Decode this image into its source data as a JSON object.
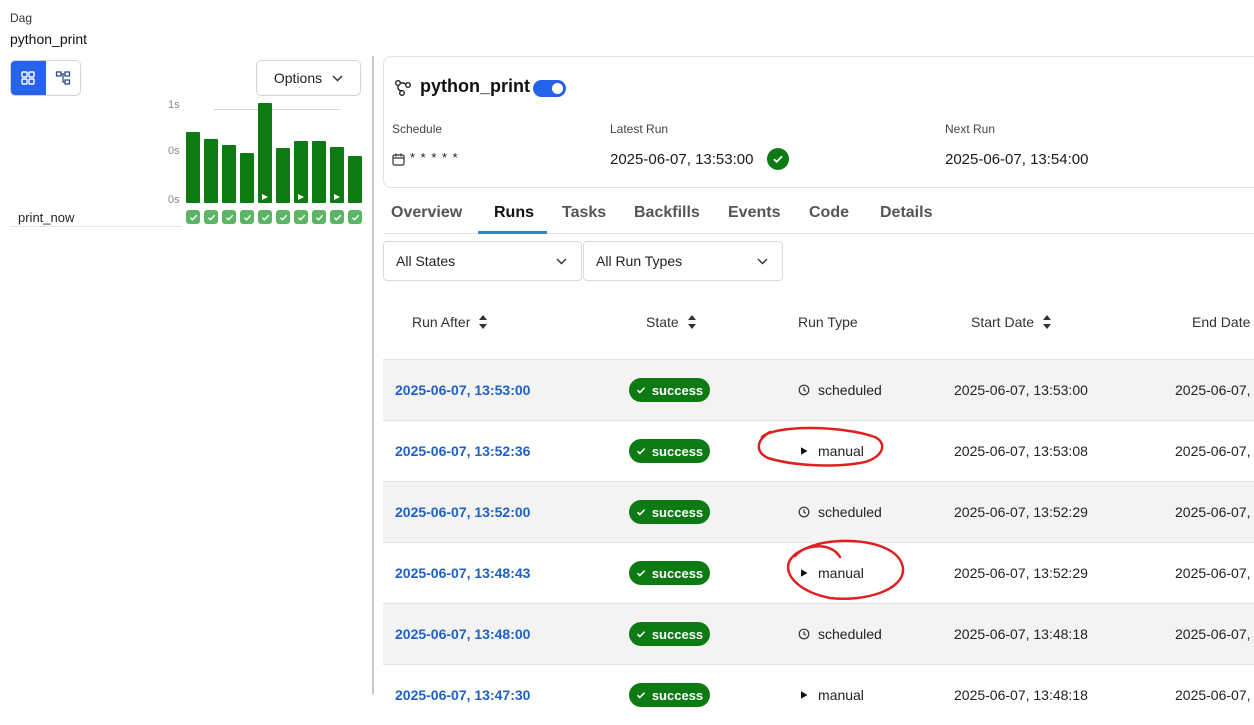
{
  "header": {
    "label": "Dag",
    "dag_name": "python_print"
  },
  "left_panel": {
    "options_label": "Options",
    "axis_labels": [
      "1s",
      "0s",
      "0s"
    ],
    "task_name": "print_now",
    "run_bars": [
      {
        "duration_fraction": 0.71,
        "manual": false
      },
      {
        "duration_fraction": 0.64,
        "manual": false
      },
      {
        "duration_fraction": 0.58,
        "manual": false
      },
      {
        "duration_fraction": 0.5,
        "manual": false
      },
      {
        "duration_fraction": 1.0,
        "manual": true
      },
      {
        "duration_fraction": 0.55,
        "manual": false
      },
      {
        "duration_fraction": 0.62,
        "manual": true
      },
      {
        "duration_fraction": 0.62,
        "manual": false
      },
      {
        "duration_fraction": 0.56,
        "manual": true
      },
      {
        "duration_fraction": 0.47,
        "manual": false
      }
    ]
  },
  "card": {
    "title": "python_print",
    "schedule_label": "Schedule",
    "schedule_value": "* * * * *",
    "latest_run_label": "Latest Run",
    "latest_run_value": "2025-06-07, 13:53:00",
    "next_run_label": "Next Run",
    "next_run_value": "2025-06-07, 13:54:00"
  },
  "tabs": [
    "Overview",
    "Runs",
    "Tasks",
    "Backfills",
    "Events",
    "Code",
    "Details"
  ],
  "active_tab": "Runs",
  "filters": {
    "state": "All States",
    "run_type": "All Run Types"
  },
  "table": {
    "headers": {
      "run_after": "Run After",
      "state": "State",
      "run_type": "Run Type",
      "start_date": "Start Date",
      "end_date": "End Date"
    },
    "rows": [
      {
        "run_after": "2025-06-07, 13:53:00",
        "state": "success",
        "run_type": "scheduled",
        "start_date": "2025-06-07, 13:53:00",
        "end_date": "2025-06-07,"
      },
      {
        "run_after": "2025-06-07, 13:52:36",
        "state": "success",
        "run_type": "manual",
        "start_date": "2025-06-07, 13:53:08",
        "end_date": "2025-06-07,"
      },
      {
        "run_after": "2025-06-07, 13:52:00",
        "state": "success",
        "run_type": "scheduled",
        "start_date": "2025-06-07, 13:52:29",
        "end_date": "2025-06-07,"
      },
      {
        "run_after": "2025-06-07, 13:48:43",
        "state": "success",
        "run_type": "manual",
        "start_date": "2025-06-07, 13:52:29",
        "end_date": "2025-06-07,"
      },
      {
        "run_after": "2025-06-07, 13:48:00",
        "state": "success",
        "run_type": "scheduled",
        "start_date": "2025-06-07, 13:48:18",
        "end_date": "2025-06-07,"
      },
      {
        "run_after": "2025-06-07, 13:47:30",
        "state": "success",
        "run_type": "manual",
        "start_date": "2025-06-07, 13:48:18",
        "end_date": "2025-06-07,"
      }
    ]
  },
  "colors": {
    "accent": "#2563eb",
    "success": "#0e7a14",
    "link": "#2160c4",
    "annotation": "#e02020"
  }
}
